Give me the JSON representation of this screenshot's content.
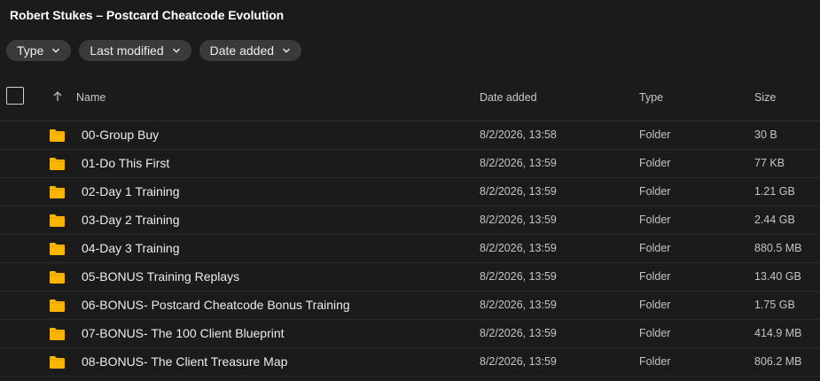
{
  "title": "Robert Stukes – Postcard Cheatcode Evolution",
  "filters": [
    {
      "label": "Type"
    },
    {
      "label": "Last modified"
    },
    {
      "label": "Date added"
    }
  ],
  "columns": {
    "name": "Name",
    "date_added": "Date added",
    "type": "Type",
    "size": "Size"
  },
  "rows": [
    {
      "name": "00-Group Buy",
      "date": "8/2/2026, 13:58",
      "type": "Folder",
      "size": "30 B"
    },
    {
      "name": "01-Do This First",
      "date": "8/2/2026, 13:59",
      "type": "Folder",
      "size": "77 KB"
    },
    {
      "name": "02-Day 1 Training",
      "date": "8/2/2026, 13:59",
      "type": "Folder",
      "size": "1.21 GB"
    },
    {
      "name": "03-Day 2 Training",
      "date": "8/2/2026, 13:59",
      "type": "Folder",
      "size": "2.44 GB"
    },
    {
      "name": "04-Day 3 Training",
      "date": "8/2/2026, 13:59",
      "type": "Folder",
      "size": "880.5 MB"
    },
    {
      "name": "05-BONUS Training Replays",
      "date": "8/2/2026, 13:59",
      "type": "Folder",
      "size": "13.40 GB"
    },
    {
      "name": "06-BONUS- Postcard Cheatcode Bonus Training",
      "date": "8/2/2026, 13:59",
      "type": "Folder",
      "size": "1.75 GB"
    },
    {
      "name": "07-BONUS- The 100 Client Blueprint",
      "date": "8/2/2026, 13:59",
      "type": "Folder",
      "size": "414.9 MB"
    },
    {
      "name": "08-BONUS- The Client Treasure Map",
      "date": "8/2/2026, 13:59",
      "type": "Folder",
      "size": "806.2 MB"
    }
  ],
  "colors": {
    "background": "#1b1b1b",
    "chip": "#3a3a3a",
    "folder": "#f9b600"
  }
}
